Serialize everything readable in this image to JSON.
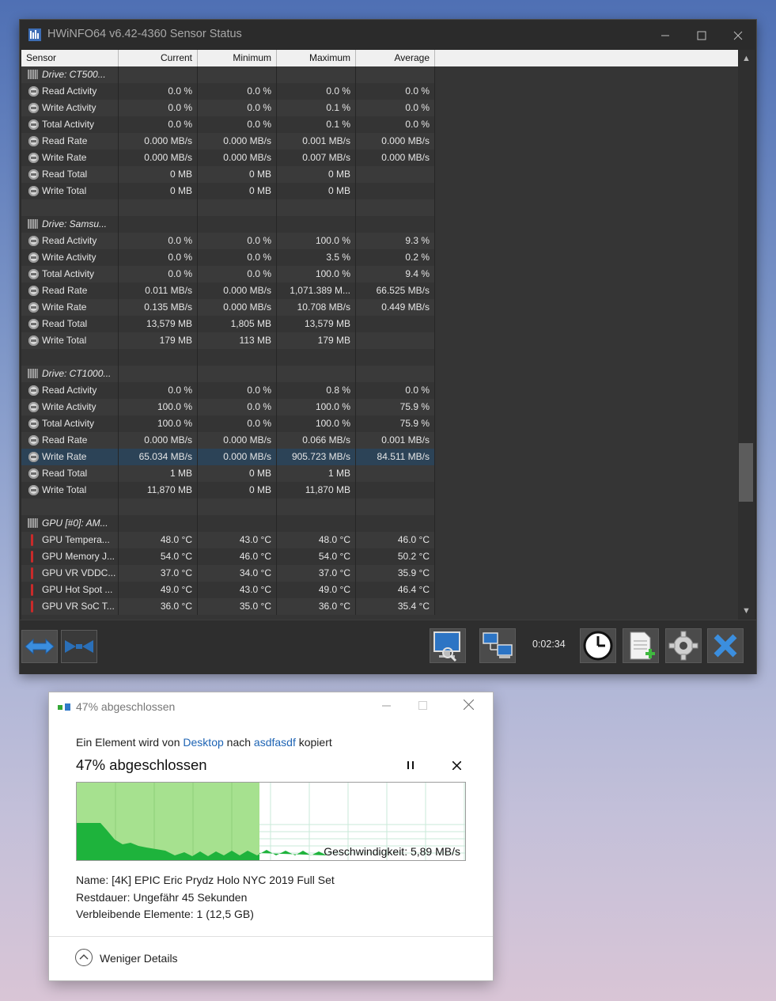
{
  "hwinfo": {
    "title": "HWiNFO64 v6.42-4360 Sensor Status",
    "columns": [
      "Sensor",
      "Current",
      "Minimum",
      "Maximum",
      "Average"
    ],
    "rows": [
      {
        "type": "hdr",
        "name": "Drive: CT500...",
        "icon": "chip-icon"
      },
      {
        "name": "Read Activity",
        "cur": "0.0 %",
        "min": "0.0 %",
        "max": "0.0 %",
        "avg": "0.0 %",
        "icon": "clock-icon"
      },
      {
        "name": "Write Activity",
        "cur": "0.0 %",
        "min": "0.0 %",
        "max": "0.1 %",
        "avg": "0.0 %",
        "icon": "clock-icon"
      },
      {
        "name": "Total Activity",
        "cur": "0.0 %",
        "min": "0.0 %",
        "max": "0.1 %",
        "avg": "0.0 %",
        "icon": "clock-icon"
      },
      {
        "name": "Read Rate",
        "cur": "0.000 MB/s",
        "min": "0.000 MB/s",
        "max": "0.001 MB/s",
        "avg": "0.000 MB/s",
        "icon": "clock-icon"
      },
      {
        "name": "Write Rate",
        "cur": "0.000 MB/s",
        "min": "0.000 MB/s",
        "max": "0.007 MB/s",
        "avg": "0.000 MB/s",
        "icon": "clock-icon"
      },
      {
        "name": "Read Total",
        "cur": "0 MB",
        "min": "0 MB",
        "max": "0 MB",
        "avg": "",
        "icon": "clock-icon"
      },
      {
        "name": "Write Total",
        "cur": "0 MB",
        "min": "0 MB",
        "max": "0 MB",
        "avg": "",
        "icon": "clock-icon"
      },
      {
        "type": "blank"
      },
      {
        "type": "hdr",
        "name": "Drive: Samsu...",
        "icon": "chip-icon"
      },
      {
        "name": "Read Activity",
        "cur": "0.0 %",
        "min": "0.0 %",
        "max": "100.0 %",
        "avg": "9.3 %",
        "icon": "clock-icon"
      },
      {
        "name": "Write Activity",
        "cur": "0.0 %",
        "min": "0.0 %",
        "max": "3.5 %",
        "avg": "0.2 %",
        "icon": "clock-icon"
      },
      {
        "name": "Total Activity",
        "cur": "0.0 %",
        "min": "0.0 %",
        "max": "100.0 %",
        "avg": "9.4 %",
        "icon": "clock-icon"
      },
      {
        "name": "Read Rate",
        "cur": "0.011 MB/s",
        "min": "0.000 MB/s",
        "max": "1,071.389 M...",
        "avg": "66.525 MB/s",
        "icon": "clock-icon"
      },
      {
        "name": "Write Rate",
        "cur": "0.135 MB/s",
        "min": "0.000 MB/s",
        "max": "10.708 MB/s",
        "avg": "0.449 MB/s",
        "icon": "clock-icon"
      },
      {
        "name": "Read Total",
        "cur": "13,579 MB",
        "min": "1,805 MB",
        "max": "13,579 MB",
        "avg": "",
        "icon": "clock-icon"
      },
      {
        "name": "Write Total",
        "cur": "179 MB",
        "min": "113 MB",
        "max": "179 MB",
        "avg": "",
        "icon": "clock-icon"
      },
      {
        "type": "blank"
      },
      {
        "type": "hdr",
        "name": "Drive: CT1000...",
        "icon": "chip-icon"
      },
      {
        "name": "Read Activity",
        "cur": "0.0 %",
        "min": "0.0 %",
        "max": "0.8 %",
        "avg": "0.0 %",
        "icon": "clock-icon"
      },
      {
        "name": "Write Activity",
        "cur": "100.0 %",
        "min": "0.0 %",
        "max": "100.0 %",
        "avg": "75.9 %",
        "icon": "clock-icon"
      },
      {
        "name": "Total Activity",
        "cur": "100.0 %",
        "min": "0.0 %",
        "max": "100.0 %",
        "avg": "75.9 %",
        "icon": "clock-icon"
      },
      {
        "name": "Read Rate",
        "cur": "0.000 MB/s",
        "min": "0.000 MB/s",
        "max": "0.066 MB/s",
        "avg": "0.001 MB/s",
        "icon": "clock-icon"
      },
      {
        "name": "Write Rate",
        "cur": "65.034 MB/s",
        "min": "0.000 MB/s",
        "max": "905.723 MB/s",
        "avg": "84.511 MB/s",
        "icon": "clock-icon",
        "selected": true
      },
      {
        "name": "Read Total",
        "cur": "1 MB",
        "min": "0 MB",
        "max": "1 MB",
        "avg": "",
        "icon": "clock-icon"
      },
      {
        "name": "Write Total",
        "cur": "11,870 MB",
        "min": "0 MB",
        "max": "11,870 MB",
        "avg": "",
        "icon": "clock-icon"
      },
      {
        "type": "blank"
      },
      {
        "type": "hdr",
        "name": "GPU [#0]: AM...",
        "icon": "chip-icon"
      },
      {
        "name": "GPU Tempera...",
        "cur": "48.0 °C",
        "min": "43.0 °C",
        "max": "48.0 °C",
        "avg": "46.0 °C",
        "icon": "thermometer-icon"
      },
      {
        "name": "GPU Memory J...",
        "cur": "54.0 °C",
        "min": "46.0 °C",
        "max": "54.0 °C",
        "avg": "50.2 °C",
        "icon": "thermometer-icon"
      },
      {
        "name": "GPU VR VDDC...",
        "cur": "37.0 °C",
        "min": "34.0 °C",
        "max": "37.0 °C",
        "avg": "35.9 °C",
        "icon": "thermometer-icon"
      },
      {
        "name": "GPU Hot Spot ...",
        "cur": "49.0 °C",
        "min": "43.0 °C",
        "max": "49.0 °C",
        "avg": "46.4 °C",
        "icon": "thermometer-icon"
      },
      {
        "name": "GPU VR SoC T...",
        "cur": "36.0 °C",
        "min": "35.0 °C",
        "max": "36.0 °C",
        "avg": "35.4 °C",
        "icon": "thermometer-icon"
      }
    ],
    "timer": "0:02:34"
  },
  "copy_dialog": {
    "title": "47% abgeschlossen",
    "line_prefix": "Ein Element wird von ",
    "source": "Desktop",
    "line_mid": " nach ",
    "destination": "asdfasdf",
    "line_suffix": " kopiert",
    "heading": "47% abgeschlossen",
    "progress_percent": 47,
    "speed_label": "Geschwindigkeit: 5,89 MB/s",
    "name_line": "Name:  [4K] EPIC Eric Prydz Holo NYC 2019 Full Set",
    "remaining_time": "Restdauer:  Ungefähr 45 Sekunden",
    "remaining_items": "Verbleibende Elemente:  1 (12,5 GB)",
    "less_details": "Weniger Details",
    "colors": {
      "fill_light": "#a6e18f",
      "fill_dark": "#1eb33c",
      "grid": "#c9ead8"
    }
  }
}
